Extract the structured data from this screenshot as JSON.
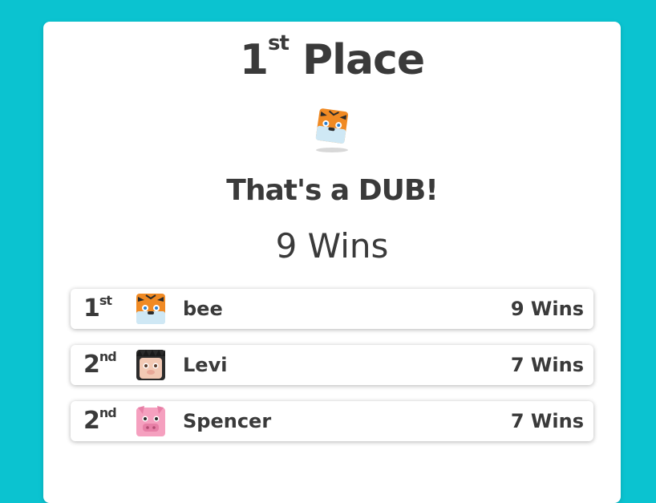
{
  "result": {
    "place_number": "1",
    "place_suffix": "st",
    "place_word": "Place",
    "tagline": "That's a DUB!",
    "wins": "9 Wins",
    "avatar": "tiger-blook-icon"
  },
  "players": [
    {
      "rank": "1",
      "suffix": "st",
      "name": "bee",
      "wins": "9 Wins",
      "avatar": "tiger-blook-icon"
    },
    {
      "rank": "2",
      "suffix": "nd",
      "name": "Levi",
      "wins": "7 Wins",
      "avatar": "hedgehog-blook-icon"
    },
    {
      "rank": "2",
      "suffix": "nd",
      "name": "Spencer",
      "wins": "7 Wins",
      "avatar": "pig-blook-icon"
    }
  ],
  "colors": {
    "background": "#0bc3d0",
    "card": "#ffffff",
    "text": "#3a3a3a"
  }
}
